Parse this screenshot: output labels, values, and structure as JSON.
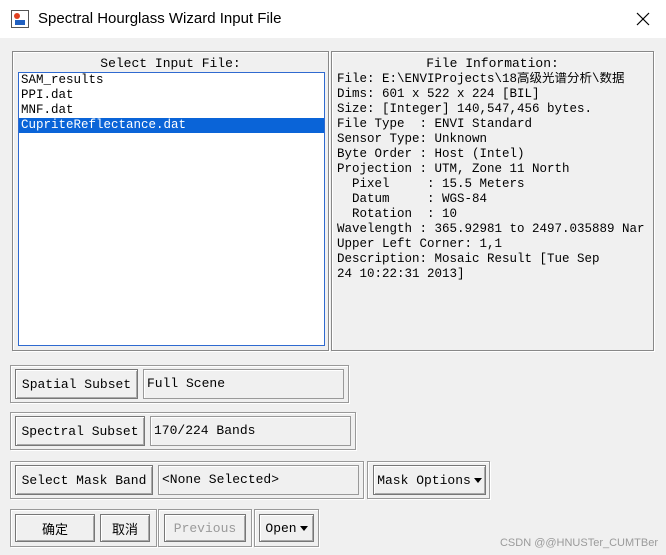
{
  "window": {
    "title": "Spectral Hourglass Wizard Input File"
  },
  "input_panel": {
    "header": "Select Input File:",
    "files": [
      "SAM_results",
      "PPI.dat",
      "MNF.dat",
      "CupriteReflectance.dat"
    ],
    "selected_index": 3
  },
  "info_panel": {
    "header": "File Information:",
    "lines": [
      "File: E:\\ENVIProjects\\18高级光谱分析\\数据",
      "Dims: 601 x 522 x 224 [BIL]",
      "Size: [Integer] 140,547,456 bytes.",
      "File Type  : ENVI Standard",
      "Sensor Type: Unknown",
      "Byte Order : Host (Intel)",
      "Projection : UTM, Zone 11 North",
      "  Pixel     : 15.5 Meters",
      "  Datum     : WGS-84",
      "  Rotation  : 10",
      "Wavelength : 365.92981 to 2497.035889 Nar",
      "Upper Left Corner: 1,1",
      "Description: Mosaic Result [Tue Sep",
      "24 10:22:31 2013]"
    ]
  },
  "spatial_subset": {
    "button": "Spatial Subset",
    "value": "Full Scene"
  },
  "spectral_subset": {
    "button": "Spectral Subset",
    "value": "170/224 Bands"
  },
  "mask": {
    "button": "Select Mask Band",
    "value": "<None Selected>",
    "options_button": "Mask Options"
  },
  "bottom": {
    "ok": "确定",
    "cancel": "取消",
    "previous": "Previous",
    "open": "Open"
  },
  "watermark": "CSDN @@HNUSTer_CUMTBer",
  "colors": {
    "selection": "#0a64d8",
    "list_border": "#2f6ad0",
    "background": "#f0f0f0"
  }
}
